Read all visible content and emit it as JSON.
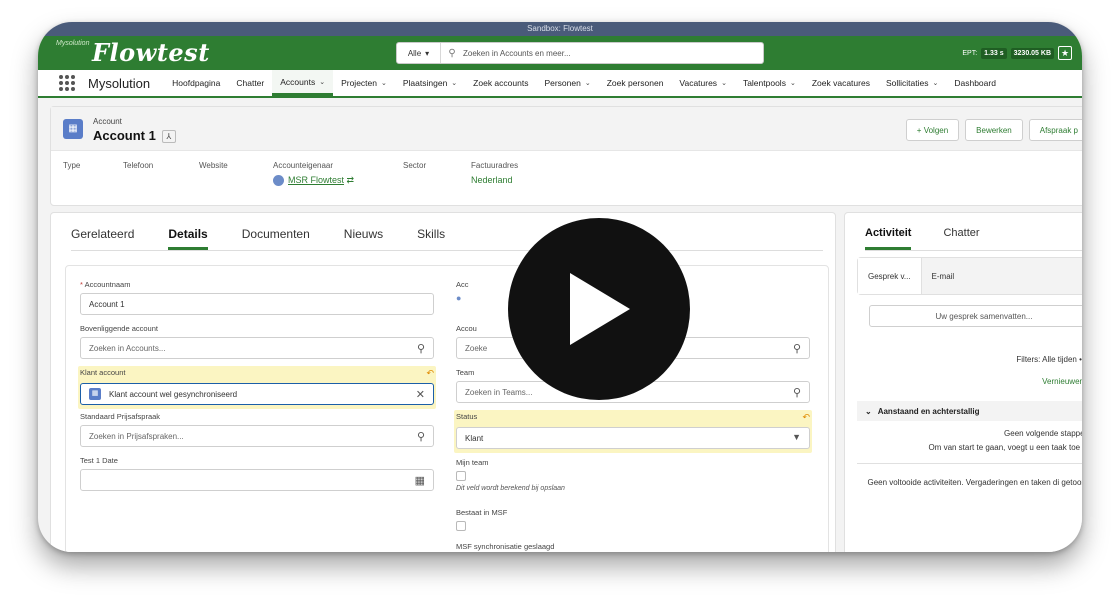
{
  "sandbox": "Sandbox: Flowtest",
  "header": {
    "logo_small": "Mysolution",
    "logo": "Flowtest",
    "search_scope": "Alle",
    "search_placeholder": "Zoeken in Accounts en meer...",
    "ept_label": "EPT:",
    "ept_value": "1.33 s",
    "size_value": "3230.05 KB"
  },
  "nav": {
    "app_name": "Mysolution",
    "items": [
      {
        "label": "Hoofdpagina",
        "chevron": false
      },
      {
        "label": "Chatter",
        "chevron": false
      },
      {
        "label": "Accounts",
        "chevron": true,
        "active": true
      },
      {
        "label": "Projecten",
        "chevron": true
      },
      {
        "label": "Plaatsingen",
        "chevron": true
      },
      {
        "label": "Zoek accounts",
        "chevron": false
      },
      {
        "label": "Personen",
        "chevron": true
      },
      {
        "label": "Zoek personen",
        "chevron": false
      },
      {
        "label": "Vacatures",
        "chevron": true
      },
      {
        "label": "Talentpools",
        "chevron": true
      },
      {
        "label": "Zoek vacatures",
        "chevron": false
      },
      {
        "label": "Sollicitaties",
        "chevron": true
      },
      {
        "label": "Dashboard",
        "chevron": false
      }
    ]
  },
  "record": {
    "object_label": "Account",
    "name": "Account 1",
    "actions": {
      "follow": "+ Volgen",
      "edit": "Bewerken",
      "appointment": "Afspraak p"
    },
    "fields": {
      "type_label": "Type",
      "phone_label": "Telefoon",
      "website_label": "Website",
      "owner_label": "Accounteigenaar",
      "owner_value": "MSR Flowtest",
      "sector_label": "Sector",
      "billing_label": "Factuuradres",
      "billing_value": "Nederland"
    }
  },
  "details": {
    "tabs": [
      "Gerelateerd",
      "Details",
      "Documenten",
      "Nieuws",
      "Skills"
    ],
    "active_tab": "Details",
    "form": {
      "accountnaam_label": "Accountnaam",
      "accountnaam_value": "Account 1",
      "bovenliggende_label": "Bovenliggende account",
      "bovenliggende_placeholder": "Zoeken in Accounts...",
      "klant_label": "Klant account",
      "klant_value": "Klant account wel gesynchroniseerd",
      "prijs_label": "Standaard Prijsafspraak",
      "prijs_placeholder": "Zoeken in Prijsafspraken...",
      "test_label": "Test 1 Date",
      "right_label_1": "Acc",
      "right_label_2": "Accou",
      "right_placeholder_2": "Zoeke",
      "team_label": "Team",
      "team_placeholder": "Zoeken in Teams...",
      "status_label": "Status",
      "status_value": "Klant",
      "mijnteam_label": "Mijn team",
      "mijnteam_note": "Dit veld wordt berekend bij opslaan",
      "bestaat_label": "Bestaat in MSF",
      "msf_sync_label": "MSF synchronisatie geslaagd"
    }
  },
  "activity": {
    "tabs": [
      "Activiteit",
      "Chatter"
    ],
    "subtabs": [
      "Gesprek v...",
      "E-mail"
    ],
    "summary_placeholder": "Uw gesprek samenvatten...",
    "filters": "Filters: Alle tijden • A",
    "refresh": "Vernieuwen •",
    "section": "Aanstaand en achterstallig",
    "no_steps": "Geen volgende stappen",
    "start_hint": "Om van start te gaan, voegt u een taak toe of",
    "no_done": "Geen voltooide activiteiten. Vergaderingen en taken di getoond."
  }
}
